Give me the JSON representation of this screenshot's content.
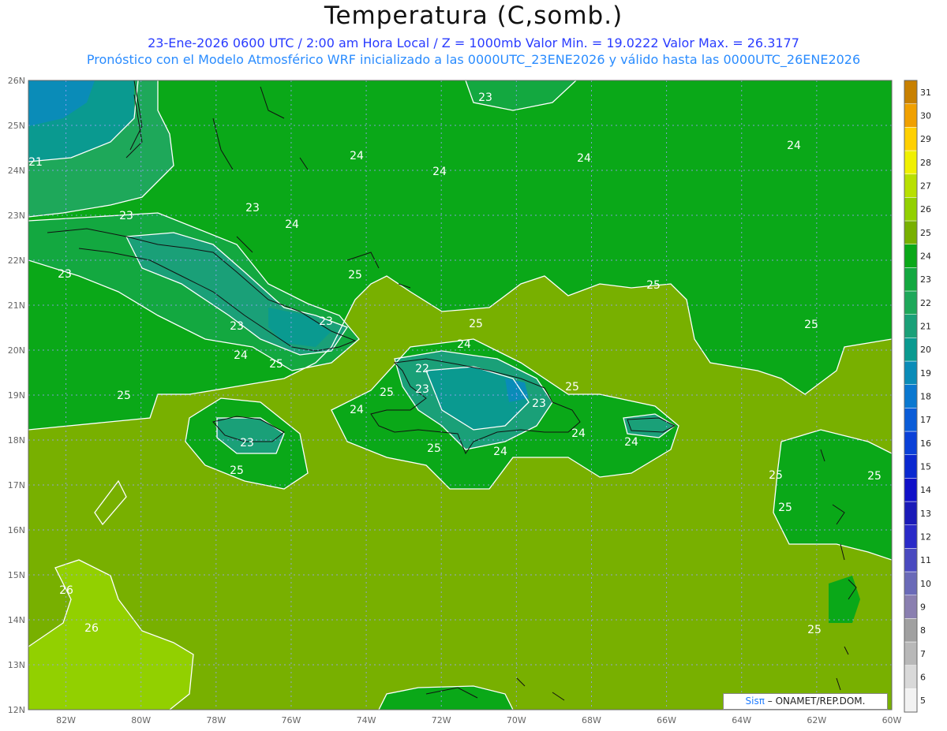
{
  "header": {
    "title": "Temperatura (C,somb.)",
    "line1": "23-Ene-2026  0600 UTC / 2:00 am Hora Local / Z = 1000mb   Valor Min. = 19.0222  Valor Max. = 26.3177",
    "line2": "Pronóstico con el Modelo Atmosférico WRF inicializado a las 0000UTC_23ENE2026 y válido hasta las  0000UTC_26ENE2026"
  },
  "axes": {
    "lat_labels": [
      "26N",
      "25N",
      "24N",
      "23N",
      "22N",
      "21N",
      "20N",
      "19N",
      "18N",
      "17N",
      "16N",
      "15N",
      "14N",
      "13N",
      "12N"
    ],
    "lon_labels": [
      "82W",
      "80W",
      "78W",
      "76W",
      "74W",
      "72W",
      "70W",
      "68W",
      "66W",
      "64W",
      "62W",
      "60W"
    ]
  },
  "colorbar": {
    "values": [
      "5",
      "6",
      "7",
      "8",
      "9",
      "10",
      "11",
      "12",
      "13",
      "14",
      "15",
      "16",
      "17",
      "18",
      "19",
      "20",
      "21",
      "22",
      "23",
      "24",
      "25",
      "26",
      "27",
      "28",
      "29",
      "30",
      "31"
    ],
    "colors": [
      "#f2f2f2",
      "#d9d9d9",
      "#b8b8b8",
      "#a0a0a0",
      "#8a7fb0",
      "#6a6ab8",
      "#4a4ac0",
      "#2a2ac8",
      "#1a1ab8",
      "#1010c8",
      "#0a28d0",
      "#0a40d8",
      "#0a5cd8",
      "#0a78d0",
      "#0a8cb8",
      "#0a9a90",
      "#1aa078",
      "#1ea85a",
      "#13a840",
      "#0aa818",
      "#78b000",
      "#92d000",
      "#b8e000",
      "#f0f000",
      "#ffd000",
      "#f0a000",
      "#c88000"
    ]
  },
  "map_labels": [
    {
      "text": "21"
    },
    {
      "text": "23"
    },
    {
      "text": "23"
    },
    {
      "text": "23"
    },
    {
      "text": "24"
    },
    {
      "text": "24"
    },
    {
      "text": "24"
    },
    {
      "text": "24"
    },
    {
      "text": "25"
    },
    {
      "text": "23"
    },
    {
      "text": "23"
    },
    {
      "text": "24"
    },
    {
      "text": "25"
    },
    {
      "text": "25"
    },
    {
      "text": "25"
    },
    {
      "text": "24"
    },
    {
      "text": "22"
    },
    {
      "text": "23"
    },
    {
      "text": "23"
    },
    {
      "text": "25"
    },
    {
      "text": "24"
    },
    {
      "text": "25"
    },
    {
      "text": "24"
    },
    {
      "text": "25"
    },
    {
      "text": "25"
    },
    {
      "text": "23"
    },
    {
      "text": "25"
    },
    {
      "text": "24"
    },
    {
      "text": "25"
    },
    {
      "text": "25"
    },
    {
      "text": "25"
    },
    {
      "text": "26"
    },
    {
      "text": "26"
    },
    {
      "text": "25"
    },
    {
      "text": "24"
    },
    {
      "text": "23"
    },
    {
      "text": "24"
    },
    {
      "text": "25"
    }
  ],
  "credit": {
    "logo": "Sisπ",
    "org": " – ONAMET/REP.DOM."
  }
}
